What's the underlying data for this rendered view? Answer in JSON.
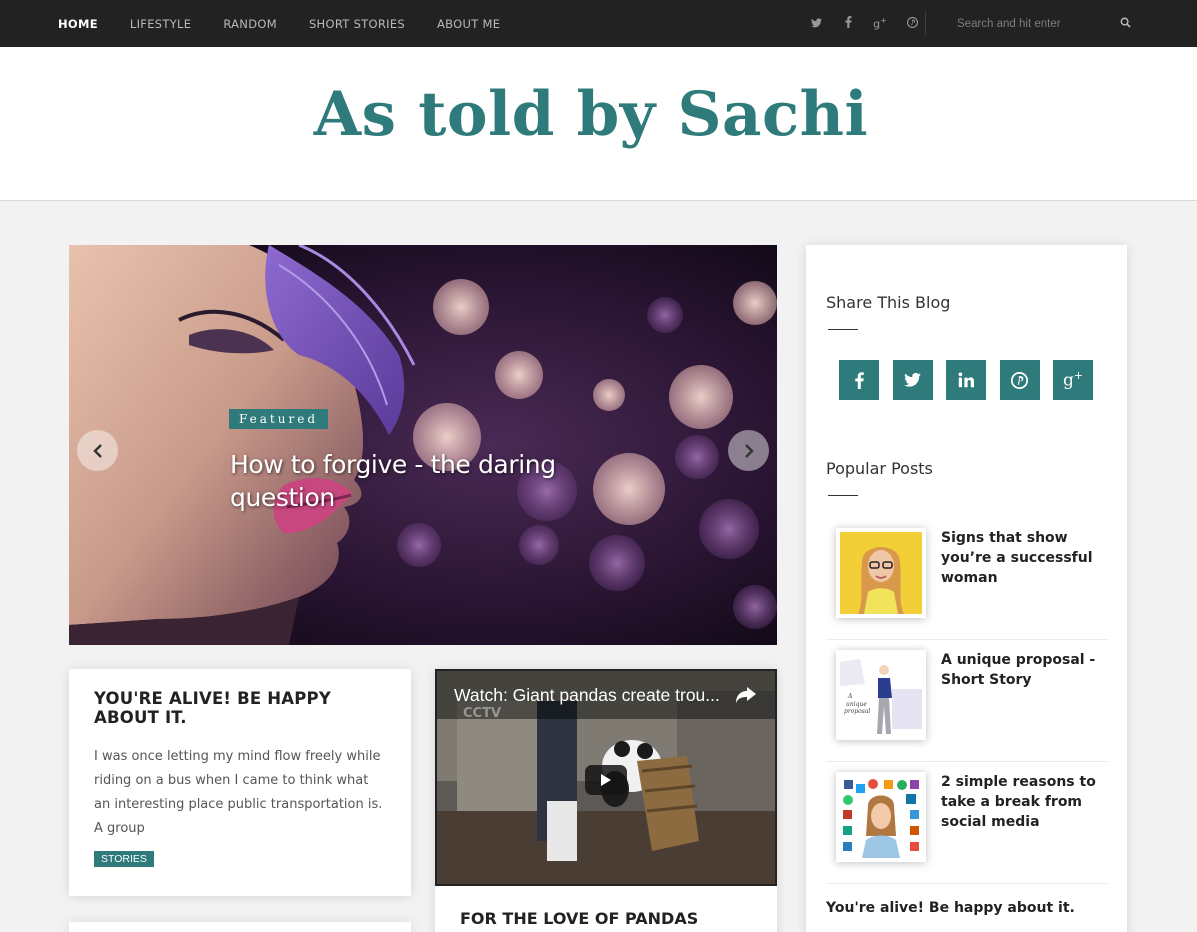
{
  "nav": {
    "items": [
      {
        "label": "HOME",
        "active": true
      },
      {
        "label": "LIFESTYLE",
        "active": false
      },
      {
        "label": "RANDOM",
        "active": false
      },
      {
        "label": "SHORT STORIES",
        "active": false
      },
      {
        "label": "ABOUT ME",
        "active": false
      }
    ],
    "social": [
      "twitter-icon",
      "facebook-icon",
      "google-plus-icon",
      "pinterest-icon"
    ],
    "search_placeholder": "Search and hit enter"
  },
  "header": {
    "title": "As told by Sachi"
  },
  "slider": {
    "badge": "Featured",
    "title": "How to forgive - the daring question"
  },
  "posts": [
    {
      "title": "YOU'RE ALIVE! BE HAPPY ABOUT IT.",
      "excerpt": "I was once letting my mind flow freely while riding on a bus when I came to think what an interesting place public transportation is.  A group",
      "tag": "STORIES"
    },
    {
      "video_title": "Watch: Giant pandas create trou...",
      "video_watermark": "CCTV NEWS",
      "title": "FOR THE LOVE OF PANDAS"
    }
  ],
  "sidebar": {
    "share_title": "Share This Blog",
    "share_buttons": [
      "facebook-icon",
      "twitter-icon",
      "linkedin-icon",
      "pinterest-icon",
      "google-plus-icon"
    ],
    "popular_title": "Popular Posts",
    "popular": [
      {
        "title": "Signs that show you’re a successful woman"
      },
      {
        "title": "A unique proposal - Short Story",
        "thumb_caption": "A unique proposal"
      },
      {
        "title": "2 simple reasons to take a break from social media"
      }
    ],
    "text_post": "You're alive! Be happy about it."
  },
  "colors": {
    "accent": "#2f7b7b",
    "topbar": "#222222"
  }
}
